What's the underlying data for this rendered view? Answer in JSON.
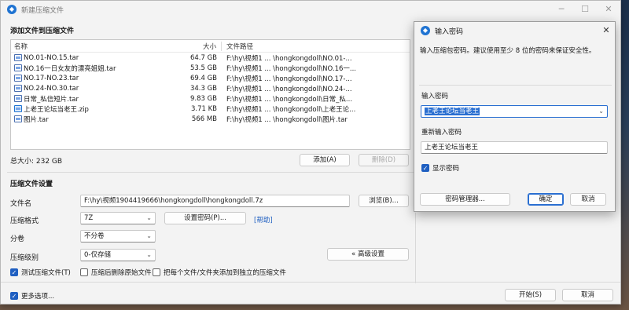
{
  "main_window": {
    "title": "新建压缩文件",
    "controls": [
      "─",
      "☐",
      "✕"
    ]
  },
  "files_section": {
    "title": "添加文件到压缩文件",
    "columns": {
      "name": "名称",
      "size": "大小",
      "path": "文件路径"
    },
    "rows": [
      {
        "name": "NO.01-NO.15.tar",
        "size": "64.7 GB",
        "path": "F:\\hy\\视频1  ...  \\hongkongdoll\\NO.01-..."
      },
      {
        "name": "NO.16一日女友的漂亮姐姐.tar",
        "size": "53.5 GB",
        "path": "F:\\hy\\视频1  ...  \\hongkongdoll\\NO.16一..."
      },
      {
        "name": "NO.17-NO.23.tar",
        "size": "69.4 GB",
        "path": "F:\\hy\\视频1  ...  \\hongkongdoll\\NO.17-..."
      },
      {
        "name": "NO.24-NO.30.tar",
        "size": "34.3 GB",
        "path": "F:\\hy\\视频1  ...  \\hongkongdoll\\NO.24-..."
      },
      {
        "name": "日常_私信短片.tar",
        "size": "9.83 GB",
        "path": "F:\\hy\\视频1  ...  \\hongkongdoll\\日常_私..."
      },
      {
        "name": "上老王论坛当老王.zip",
        "size": "3.71 KB",
        "path": "F:\\hy\\视频1  ...  \\hongkongdoll\\上老王论..."
      },
      {
        "name": "图片.tar",
        "size": "566 MB",
        "path": "F:\\hy\\视频1  ...  \\hongkongdoll\\图片.tar"
      }
    ],
    "total_label": "总大小: 232 GB",
    "add_button": "添加(A)",
    "delete_button": "删除(D)"
  },
  "settings_section": {
    "title": "压缩文件设置",
    "filename_label": "文件名",
    "filename_value": "F:\\hy\\视频1904419666\\hongkongdoll\\hongkongdoll.7z",
    "browse_button": "浏览(B)...",
    "format_label": "压缩格式",
    "format_value": "7Z",
    "set_password_button": "设置密码(P)...",
    "help_link": "[帮助]",
    "split_label": "分卷",
    "split_value": "不分卷",
    "level_label": "压缩级别",
    "level_value": "0-仅存储",
    "advanced_button": "« 高级设置",
    "test_archive": "测试压缩文件(T)",
    "delete_after": "压缩后删除原始文件",
    "separate_archives": "把每个文件/文件夹添加到独立的压缩文件",
    "more_options": "更多选项...",
    "start_button": "开始(S)",
    "cancel_button": "取消"
  },
  "password_dialog": {
    "title": "输入密码",
    "close": "✕",
    "description": "输入压缩包密码。建议使用至少 8 位的密码来保证安全性。",
    "enter_label": "输入密码",
    "enter_value": "上老王论坛当老王",
    "reenter_label": "重新输入密码",
    "reenter_value": "上老王论坛当老王",
    "show_password": "显示密码",
    "manager_button": "密码管理器...",
    "ok_button": "确定",
    "cancel_button": "取消"
  }
}
